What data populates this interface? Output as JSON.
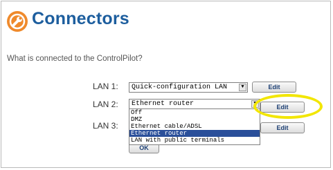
{
  "header": {
    "title": "Connectors",
    "logo_icon": "wrench-icon"
  },
  "question": "What is connected to the ControlPilot?",
  "lans": [
    {
      "label": "LAN 1:",
      "value": "Quick-configuration LAN",
      "button": "Edit"
    },
    {
      "label": "LAN 2:",
      "value": "Ethernet router",
      "button": "Edit"
    },
    {
      "label": "LAN 3:",
      "value": "",
      "button": "Edit"
    }
  ],
  "dropdown": {
    "options": [
      "Off",
      "DMZ",
      "Ethernet cable/ADSL",
      "Ethernet router",
      "LAN with public terminals"
    ],
    "selected_index": 3
  },
  "ok_label": "OK",
  "colors": {
    "title": "#1d5e9e",
    "logo": "#ef8a2c",
    "highlight": "#f2e600",
    "selected_option": "#2a4f9a"
  }
}
